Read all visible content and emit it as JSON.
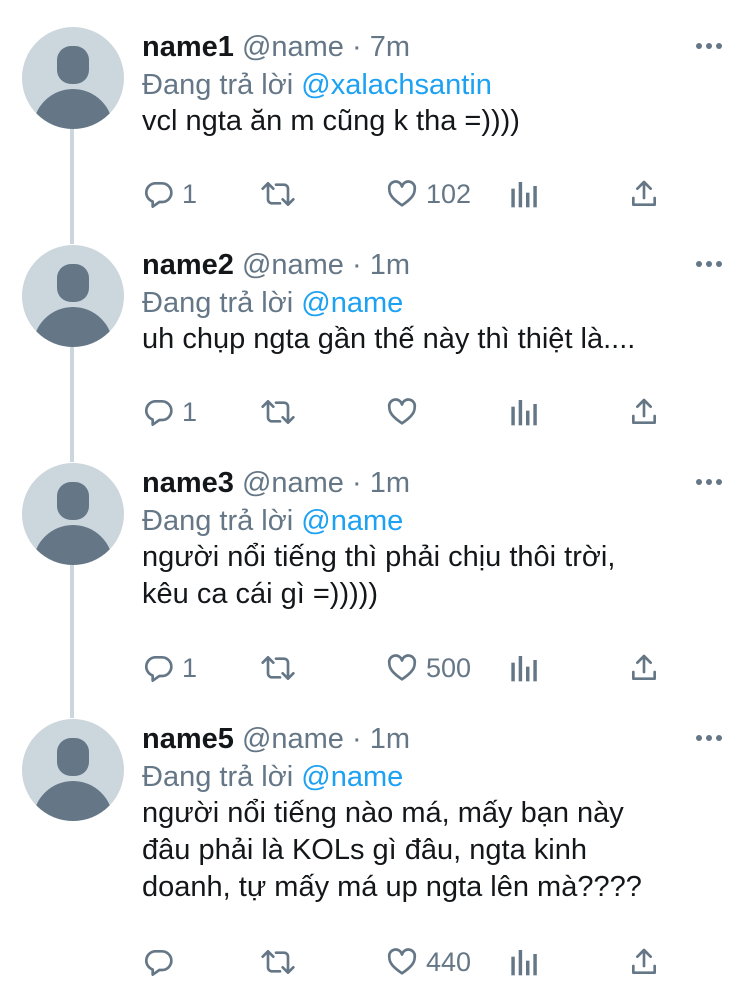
{
  "colors": {
    "mention": "#1da1f2",
    "secondary_text": "#657786",
    "avatar_bg": "#ccd6dd"
  },
  "icons": [
    "reply-icon",
    "retweet-icon",
    "like-icon",
    "analytics-icon",
    "share-icon",
    "more-icon",
    "default-avatar-icon"
  ],
  "tweets": [
    {
      "display_name": "name1",
      "handle": "@name",
      "separator": "·",
      "time": "7m",
      "reply_prefix": "Đang trả lời",
      "reply_mention": "@xalachsantin",
      "text_lines": [
        "vcl ngta ăn m cũng k tha =))))"
      ],
      "reply_count": "1",
      "retweet_count": "",
      "like_count": "102"
    },
    {
      "display_name": "name2",
      "handle": "@name",
      "separator": "·",
      "time": "1m",
      "reply_prefix": "Đang trả lời",
      "reply_mention": "@name",
      "text_lines": [
        "uh chụp ngta gần thế này thì thiệt là...."
      ],
      "reply_count": "1",
      "retweet_count": "",
      "like_count": ""
    },
    {
      "display_name": "name3",
      "handle": "@name",
      "separator": "·",
      "time": "1m",
      "reply_prefix": "Đang trả lời",
      "reply_mention": "@name",
      "text_lines": [
        "người nổi tiếng thì phải chịu thôi trời,",
        "kêu ca cái gì =)))))"
      ],
      "reply_count": "1",
      "retweet_count": "",
      "like_count": "500"
    },
    {
      "display_name": "name5",
      "handle": "@name",
      "separator": "·",
      "time": "1m",
      "reply_prefix": "Đang trả lời",
      "reply_mention": "@name",
      "text_lines": [
        "người nổi tiếng nào má, mấy bạn này",
        "đâu phải là KOLs gì đâu, ngta kinh",
        "doanh, tự mấy má up ngta lên mà????"
      ],
      "reply_count": "",
      "retweet_count": "",
      "like_count": "440"
    }
  ]
}
